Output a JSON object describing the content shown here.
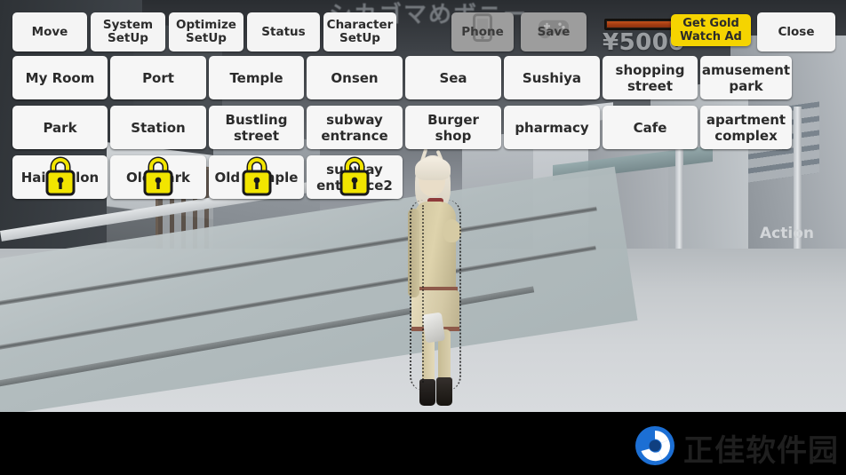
{
  "background": {
    "jp_title_partial": "シカゴマめボニー",
    "action_label": "Action"
  },
  "toolbar": {
    "buttons": [
      {
        "label": "Move",
        "name": "move-button",
        "icon": null
      },
      {
        "label": "System\nSetUp",
        "name": "system-setup-button",
        "icon": null
      },
      {
        "label": "Optimize\nSetUp",
        "name": "optimize-setup-button",
        "icon": null
      },
      {
        "label": "Status",
        "name": "status-button",
        "icon": null
      },
      {
        "label": "Character\nSetUp",
        "name": "character-setup-button",
        "icon": null
      },
      {
        "label": "Phone",
        "name": "phone-button",
        "icon": "smartphone-icon"
      },
      {
        "label": "Save",
        "name": "save-button",
        "icon": "gamepad-icon"
      },
      {
        "label": "Close",
        "name": "close-button",
        "icon": null
      }
    ],
    "close_label": "Close",
    "phone_label": "Phone",
    "save_label": "Save"
  },
  "status": {
    "money": "¥5000",
    "hp_bar_percent": 96,
    "hp_bar_color": "#a63d12",
    "ad_button_label": "Get Gold\nWatch Ad",
    "ad_button_color": "#f5d400"
  },
  "locations": {
    "rows": [
      [
        {
          "label": "My Room",
          "locked": false
        },
        {
          "label": "Port",
          "locked": false
        },
        {
          "label": "Temple",
          "locked": false
        },
        {
          "label": "Onsen",
          "locked": false
        },
        {
          "label": "Sea",
          "locked": false
        },
        {
          "label": "Sushiya",
          "locked": false
        },
        {
          "label": "shopping\nstreet",
          "locked": false
        },
        {
          "label": "amusement\npark",
          "locked": false
        }
      ],
      [
        {
          "label": "Park",
          "locked": false
        },
        {
          "label": "Station",
          "locked": false
        },
        {
          "label": "Bustling\nstreet",
          "locked": false
        },
        {
          "label": "subway\nentrance",
          "locked": false
        },
        {
          "label": "Burger\nshop",
          "locked": false
        },
        {
          "label": "pharmacy",
          "locked": false
        },
        {
          "label": "Cafe",
          "locked": false
        },
        {
          "label": "apartment\ncomplex",
          "locked": false
        }
      ],
      [
        {
          "label": "Hair Salon",
          "locked": true
        },
        {
          "label": "Old Park",
          "locked": true
        },
        {
          "label": "Old Temple",
          "locked": true
        },
        {
          "label": "subway\nentrance2",
          "locked": true
        }
      ]
    ],
    "lock_color": "#f2e500"
  },
  "watermark": {
    "text": "正佳软件园",
    "logo_color": "#1c6fd4"
  }
}
